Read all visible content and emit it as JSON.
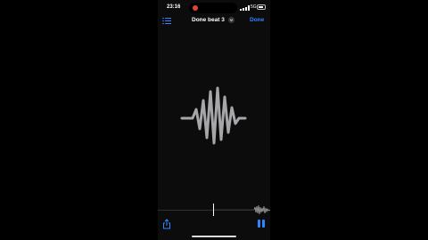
{
  "status_bar": {
    "time": "23:16",
    "network": "5G",
    "recording_indicator_color": "#e0443a"
  },
  "nav": {
    "title": "Done beat 3",
    "done_label": "Done",
    "accent_color": "#2f84ff"
  },
  "playback": {
    "state": "playing"
  },
  "icons": {
    "list": "list-icon",
    "chevron": "chevron-down-icon",
    "share": "share-icon",
    "pause": "pause-icon"
  }
}
